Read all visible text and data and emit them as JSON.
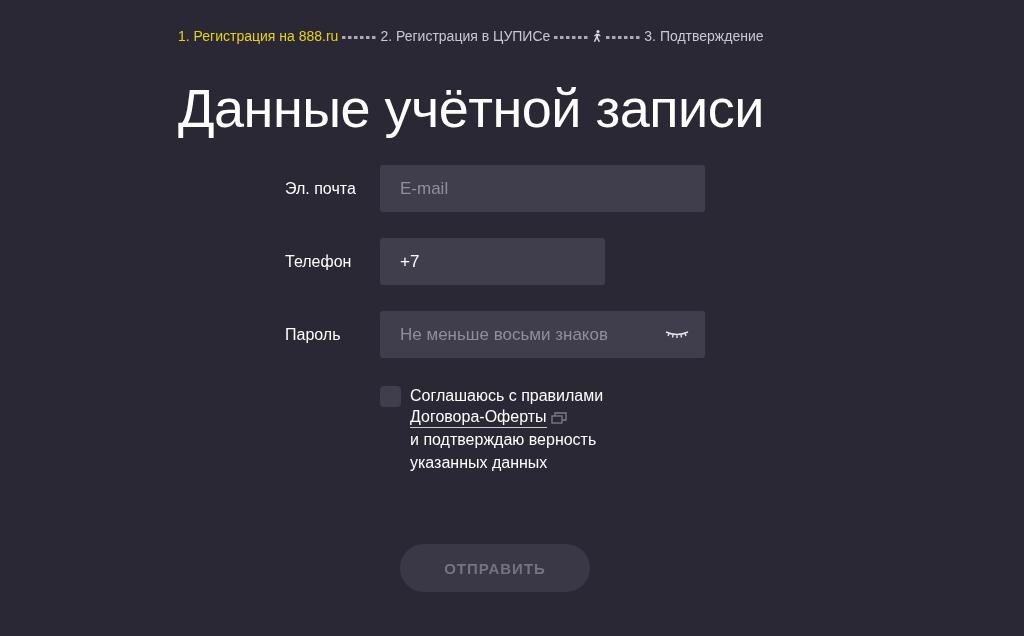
{
  "steps": [
    {
      "label": "1. Регистрация на 888.ru",
      "selected": true,
      "marker": false
    },
    {
      "label": "2. Регистрация в ЦУПИСе",
      "selected": false,
      "marker": false
    },
    {
      "label": "3. Подтверждение",
      "selected": false,
      "marker": true
    }
  ],
  "title": "Данные учётной записи",
  "fields": [
    {
      "kind": "email",
      "label": "Эл. почта",
      "placeholder": "E-mail"
    },
    {
      "kind": "phone",
      "label": "Телефон",
      "value": "+7"
    },
    {
      "kind": "password",
      "label": "Пароль",
      "placeholder": "Не меньше восьми знаков"
    }
  ],
  "agreement": {
    "checked": false,
    "before": "Соглашаюсь с правилами",
    "link": "Договора-Оферты",
    "after": "и подтверждаю верность указанных данных"
  },
  "submit": {
    "label": "ОТПРАВИТЬ",
    "disabled": true
  }
}
